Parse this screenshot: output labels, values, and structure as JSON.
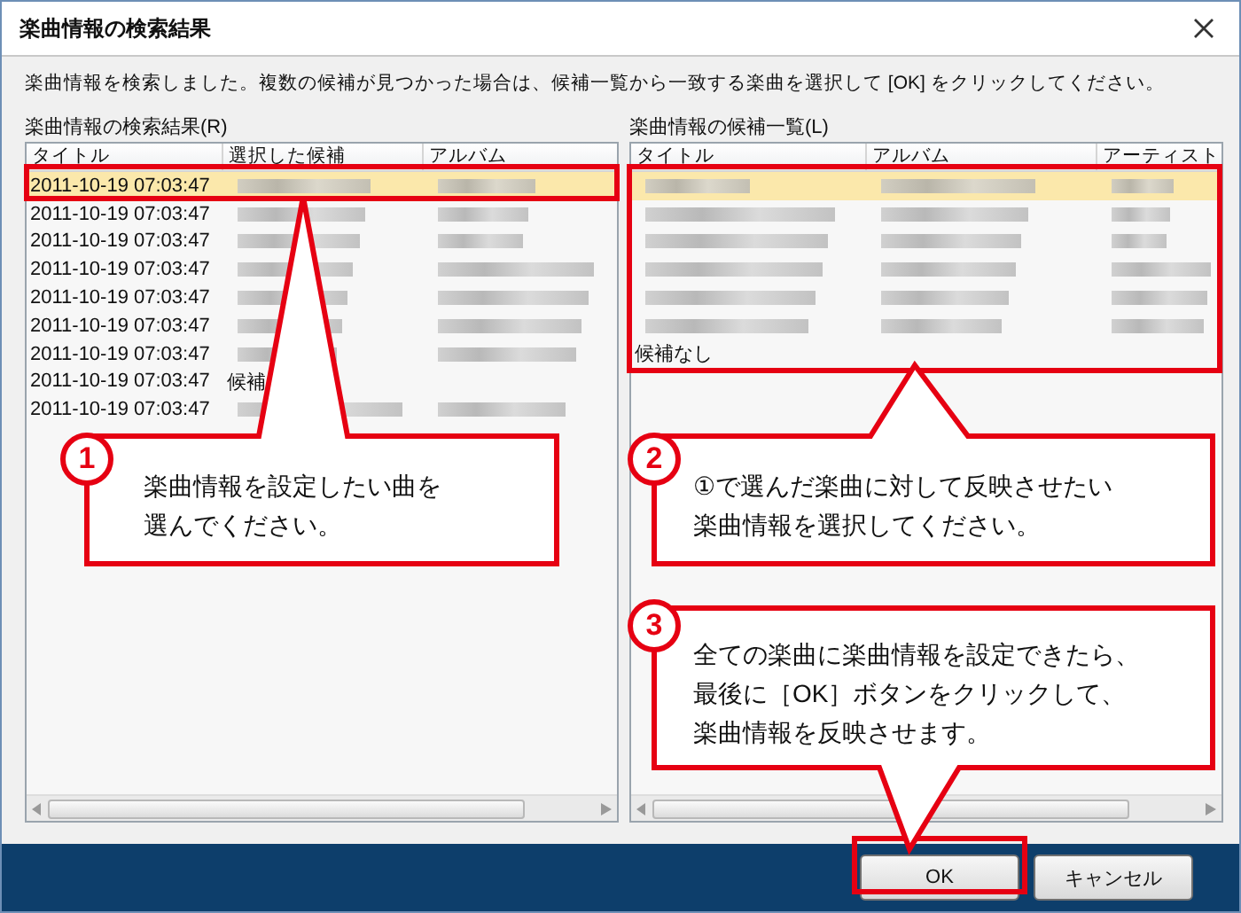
{
  "window": {
    "title": "楽曲情報の検索結果"
  },
  "instruction": "楽曲情報を検索しました。複数の候補が見つかった場合は、候補一覧から一致する楽曲を選択して [OK] をクリックしてください。",
  "panes": [
    {
      "label": "楽曲情報の検索結果(R)",
      "columns": [
        "タイトル",
        "選択した候補",
        "アルバム"
      ],
      "rows": [
        {
          "selected": true,
          "cells": [
            {
              "kind": "text",
              "text": "2011-10-19 07:03:47"
            },
            {
              "kind": "redacted"
            },
            {
              "kind": "redacted"
            }
          ]
        },
        {
          "selected": false,
          "cells": [
            {
              "kind": "text",
              "text": "2011-10-19 07:03:47"
            },
            {
              "kind": "redacted"
            },
            {
              "kind": "redacted"
            }
          ]
        },
        {
          "selected": false,
          "cells": [
            {
              "kind": "text",
              "text": "2011-10-19 07:03:47"
            },
            {
              "kind": "redacted"
            },
            {
              "kind": "redacted"
            }
          ]
        },
        {
          "selected": false,
          "cells": [
            {
              "kind": "text",
              "text": "2011-10-19 07:03:47"
            },
            {
              "kind": "redacted"
            },
            {
              "kind": "redacted"
            }
          ]
        },
        {
          "selected": false,
          "cells": [
            {
              "kind": "text",
              "text": "2011-10-19 07:03:47"
            },
            {
              "kind": "redacted"
            },
            {
              "kind": "redacted"
            }
          ]
        },
        {
          "selected": false,
          "cells": [
            {
              "kind": "text",
              "text": "2011-10-19 07:03:47"
            },
            {
              "kind": "redacted"
            },
            {
              "kind": "redacted"
            }
          ]
        },
        {
          "selected": false,
          "cells": [
            {
              "kind": "text",
              "text": "2011-10-19 07:03:47"
            },
            {
              "kind": "redacted"
            },
            {
              "kind": "redacted"
            }
          ]
        },
        {
          "selected": false,
          "cells": [
            {
              "kind": "text",
              "text": "2011-10-19 07:03:47"
            },
            {
              "kind": "text",
              "text": "候補"
            }
          ]
        },
        {
          "selected": false,
          "cells": [
            {
              "kind": "text",
              "text": "2011-10-19 07:03:47"
            },
            {
              "kind": "redacted"
            },
            {
              "kind": "redacted"
            }
          ]
        }
      ]
    },
    {
      "label": "楽曲情報の候補一覧(L)",
      "columns": [
        "タイトル",
        "アルバム",
        "アーティスト"
      ],
      "rows": [
        {
          "selected": true,
          "cells": [
            {
              "kind": "redacted"
            },
            {
              "kind": "redacted"
            },
            {
              "kind": "redacted"
            }
          ]
        },
        {
          "selected": false,
          "cells": [
            {
              "kind": "redacted"
            },
            {
              "kind": "redacted"
            },
            {
              "kind": "redacted"
            }
          ]
        },
        {
          "selected": false,
          "cells": [
            {
              "kind": "redacted"
            },
            {
              "kind": "redacted"
            },
            {
              "kind": "redacted"
            }
          ]
        },
        {
          "selected": false,
          "cells": [
            {
              "kind": "redacted"
            },
            {
              "kind": "redacted"
            },
            {
              "kind": "redacted"
            }
          ]
        },
        {
          "selected": false,
          "cells": [
            {
              "kind": "redacted"
            },
            {
              "kind": "redacted"
            },
            {
              "kind": "redacted"
            }
          ]
        },
        {
          "selected": false,
          "cells": [
            {
              "kind": "redacted"
            },
            {
              "kind": "redacted"
            },
            {
              "kind": "redacted"
            }
          ]
        },
        {
          "selected": false,
          "cells": [
            {
              "kind": "text",
              "text": "候補なし"
            }
          ]
        }
      ]
    }
  ],
  "buttons": [
    "OK",
    "キャンセル"
  ],
  "callouts": [
    {
      "number": "1",
      "lines": [
        "楽曲情報を設定したい曲を",
        "選んでください。"
      ]
    },
    {
      "number": "2",
      "lines": [
        "①で選んだ楽曲に対して反映させたい",
        "楽曲情報を選択してください。"
      ]
    },
    {
      "number": "3",
      "lines": [
        "全ての楽曲に楽曲情報を設定できたら、",
        "最後に［OK］ボタンをクリックして、",
        "楽曲情報を反映させます。"
      ]
    }
  ]
}
